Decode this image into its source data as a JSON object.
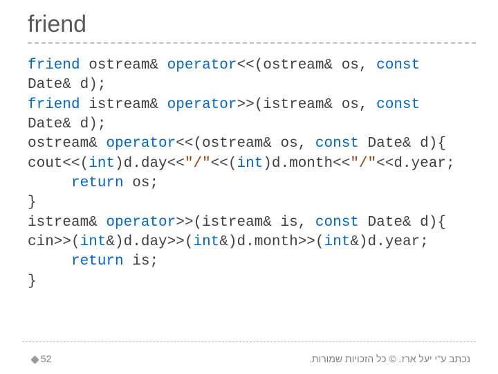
{
  "title": "friend",
  "code": {
    "l1a": "friend",
    "l1b": " ostream& ",
    "l1c": "operator",
    "l1d": "<<(ostream& os, ",
    "l1e": "const",
    "l2a": "Date& d);",
    "l3a": "friend",
    "l3b": " istream& ",
    "l3c": "operator",
    "l3d": ">>(istream& os, ",
    "l3e": "const",
    "l4a": "Date& d);",
    "l5a": "ostream& ",
    "l5b": "operator",
    "l5c": "<<(ostream& os, ",
    "l5d": "const",
    "l5e": " Date& d){",
    "l6a": "cout<<(",
    "l6b": "int",
    "l6c": ")d.day<<",
    "l6d": "\"/\"",
    "l6e": "<<(",
    "l6f": "int",
    "l6g": ")d.month<<",
    "l6h": "\"/\"",
    "l6i": "<<d.year;",
    "l7a": "     ",
    "l7b": "return",
    "l7c": " os;",
    "l8a": "}",
    "l9a": "istream& ",
    "l9b": "operator",
    "l9c": ">>(istream& is, ",
    "l9d": "const",
    "l9e": " Date& d){",
    "l10a": "cin>>(",
    "l10b": "int",
    "l10c": "&)d.day>>(",
    "l10d": "int",
    "l10e": "&)d.month>>(",
    "l10f": "int",
    "l10g": "&)d.year;",
    "l11a": "     ",
    "l11b": "return",
    "l11c": " is;",
    "l12a": "}"
  },
  "footer": {
    "page": "52",
    "credit": "נכתב ע\"י יעל ארז. © כל הזכויות שמורות."
  }
}
